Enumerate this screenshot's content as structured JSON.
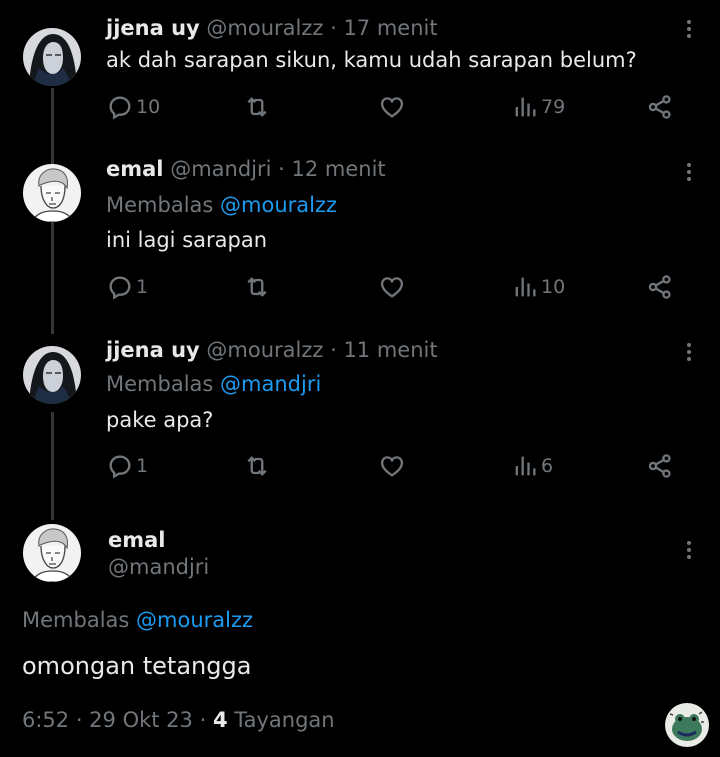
{
  "tweets": [
    {
      "name": "jjena uy",
      "handle": "@mouralzz",
      "time": "· 17 menit",
      "text": "ak dah sarapan sikun, kamu udah sarapan belum?",
      "replies": "10",
      "views": "79"
    },
    {
      "name": "emal",
      "handle": "@mandjri",
      "time": "· 12 menit",
      "reply_prefix": "Membalas",
      "reply_to": "@mouralzz",
      "text": "ini lagi sarapan",
      "replies": "1",
      "views": "10"
    },
    {
      "name": "jjena uy",
      "handle": "@mouralzz",
      "time": "· 11 menit",
      "reply_prefix": "Membalas",
      "reply_to": "@mandjri",
      "text": "pake apa?",
      "replies": "1",
      "views": "6"
    }
  ],
  "main": {
    "name": "emal",
    "handle": "@mandjri",
    "reply_prefix": "Membalas",
    "reply_to": "@mouralzz",
    "text": "omongan tetangga",
    "timestamp": "6:52 · 29 Okt 23 ·",
    "views_count": "4",
    "views_label": "Tayangan"
  },
  "icons": [
    "avatar-female-hood",
    "avatar-male-sketch",
    "reply-icon",
    "retweet-icon",
    "like-icon",
    "views-icon",
    "share-icon",
    "more-icon",
    "frog-sticker-icon"
  ],
  "colors": {
    "background": "#000000",
    "text": "#e7e9ea",
    "muted": "#71767b",
    "link": "#1d9bf0",
    "thread_line": "#333639"
  }
}
